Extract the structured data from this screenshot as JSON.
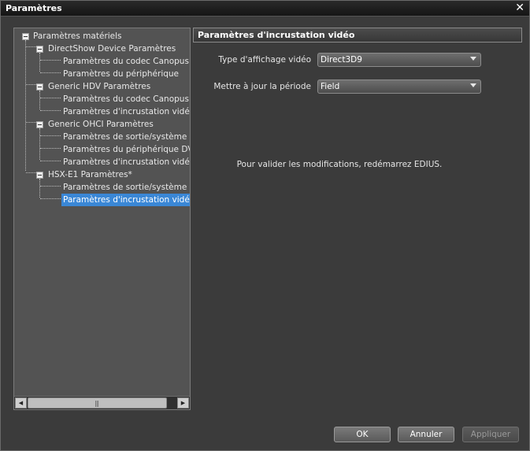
{
  "window": {
    "title": "Paramètres",
    "close_glyph": "✕"
  },
  "tree": {
    "root": "Paramètres matériels",
    "groups": [
      {
        "label": "DirectShow Device Paramètres",
        "children": [
          "Paramètres du codec Canopus HQ",
          "Paramètres du périphérique"
        ]
      },
      {
        "label": "Generic HDV Paramètres",
        "children": [
          "Paramètres du codec Canopus HQ",
          "Paramètres d'incrustation vidéo"
        ]
      },
      {
        "label": "Generic OHCI Paramètres",
        "children": [
          "Paramètres de sortie/système",
          "Paramètres du périphérique DV",
          "Paramètres d'incrustation vidéo"
        ]
      },
      {
        "label": "HSX-E1 Paramètres*",
        "children": [
          "Paramètres de sortie/système",
          "Paramètres d'incrustation vidéo"
        ]
      }
    ]
  },
  "scrollbar": {
    "left_arrow": "◀",
    "right_arrow": "▶",
    "grip": "|||"
  },
  "panel": {
    "title": "Paramètres d'incrustation vidéo",
    "fields": [
      {
        "label": "Type d'affichage vidéo",
        "value": "Direct3D9"
      },
      {
        "label": "Mettre à jour la période",
        "value": "Field"
      }
    ],
    "notice": "Pour valider les modifications, redémarrez EDIUS."
  },
  "buttons": {
    "ok": "OK",
    "cancel": "Annuler",
    "apply": "Appliquer"
  }
}
